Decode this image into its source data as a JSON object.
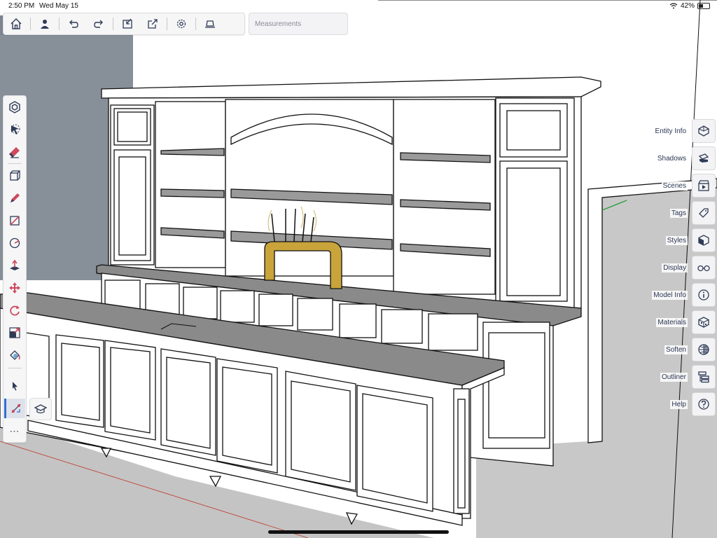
{
  "status_bar": {
    "time": "2:50 PM",
    "date": "Wed May 15",
    "battery": "42%",
    "battery_level": 0.42
  },
  "top_toolbar": {
    "buttons": [
      {
        "name": "home",
        "icon": "home-icon"
      },
      {
        "name": "profile",
        "icon": "person-icon"
      },
      {
        "name": "undo",
        "icon": "undo-icon"
      },
      {
        "name": "redo",
        "icon": "redo-icon"
      },
      {
        "name": "import",
        "icon": "import-icon"
      },
      {
        "name": "export",
        "icon": "export-icon"
      },
      {
        "name": "settings",
        "icon": "gear-icon"
      },
      {
        "name": "display-mode",
        "icon": "laptop-icon"
      }
    ],
    "measurements_placeholder": "Measurements"
  },
  "left_toolbar": {
    "tools": [
      "select-component-icon",
      "lasso-icon",
      "eraser-icon",
      "box-select-icon",
      "pencil-icon",
      "line-icon",
      "circle-icon",
      "push-pull-icon",
      "move-icon",
      "rotate-icon",
      "scale-icon",
      "paint-icon",
      "select-arrow-icon",
      "tool-assist-icon"
    ],
    "more": "⋯"
  },
  "right_panel": {
    "items": [
      {
        "label": "Entity Info",
        "icon": "entity-info-icon"
      },
      {
        "label": "Shadows",
        "icon": "shadows-icon"
      },
      {
        "label": "Scenes",
        "icon": "scenes-icon"
      },
      {
        "label": "Tags",
        "icon": "tag-icon"
      },
      {
        "label": "Styles",
        "icon": "styles-icon"
      },
      {
        "label": "Display",
        "icon": "glasses-icon"
      },
      {
        "label": "Model Info",
        "icon": "info-icon"
      },
      {
        "label": "Materials",
        "icon": "materials-icon"
      },
      {
        "label": "Soften",
        "icon": "soften-icon"
      },
      {
        "label": "Outliner",
        "icon": "outliner-icon"
      },
      {
        "label": "Help",
        "icon": "help-icon"
      }
    ]
  },
  "colors": {
    "accent": "#2f6fd0",
    "counter": "#8a8a8a",
    "tap_brass": "#c9a43a",
    "wall": "#878f99"
  }
}
